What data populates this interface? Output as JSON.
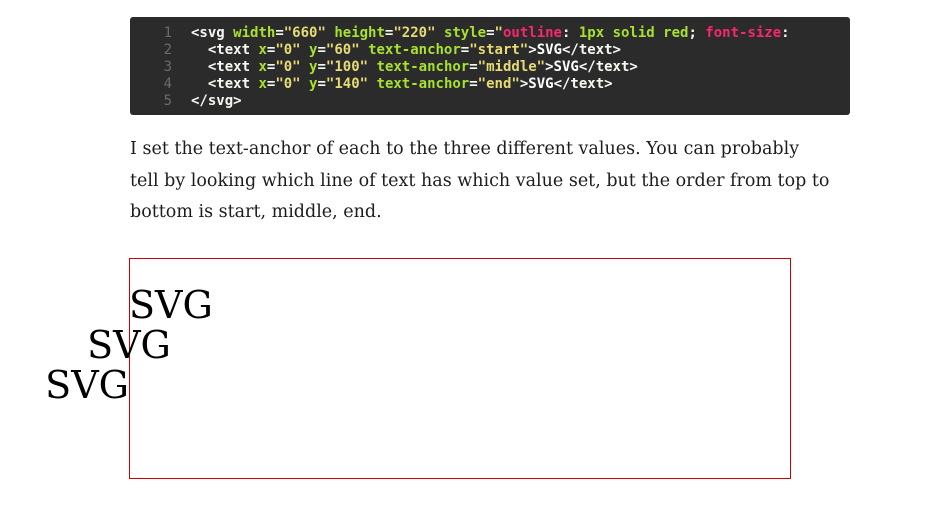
{
  "code": {
    "lines": [
      {
        "num": "1",
        "parts": [
          {
            "cls": "tag",
            "text": "<svg "
          },
          {
            "cls": "attr",
            "text": "width"
          },
          {
            "cls": "tag",
            "text": "="
          },
          {
            "cls": "str",
            "text": "\"660\""
          },
          {
            "cls": "tag",
            "text": " "
          },
          {
            "cls": "attr",
            "text": "height"
          },
          {
            "cls": "tag",
            "text": "="
          },
          {
            "cls": "str",
            "text": "\"220\""
          },
          {
            "cls": "tag",
            "text": " "
          },
          {
            "cls": "attr",
            "text": "style"
          },
          {
            "cls": "tag",
            "text": "="
          },
          {
            "cls": "str",
            "text": "\""
          },
          {
            "cls": "css-prop",
            "text": "outline"
          },
          {
            "cls": "tag",
            "text": ": "
          },
          {
            "cls": "css-val",
            "text": "1px solid red"
          },
          {
            "cls": "tag",
            "text": "; "
          },
          {
            "cls": "css-prop",
            "text": "font-size"
          },
          {
            "cls": "tag",
            "text": ":"
          }
        ]
      },
      {
        "num": "2",
        "parts": [
          {
            "cls": "tag",
            "text": "  <text "
          },
          {
            "cls": "attr",
            "text": "x"
          },
          {
            "cls": "tag",
            "text": "="
          },
          {
            "cls": "str",
            "text": "\"0\""
          },
          {
            "cls": "tag",
            "text": " "
          },
          {
            "cls": "attr",
            "text": "y"
          },
          {
            "cls": "tag",
            "text": "="
          },
          {
            "cls": "str",
            "text": "\"60\""
          },
          {
            "cls": "tag",
            "text": " "
          },
          {
            "cls": "attr",
            "text": "text-anchor"
          },
          {
            "cls": "tag",
            "text": "="
          },
          {
            "cls": "str",
            "text": "\"start\""
          },
          {
            "cls": "tag",
            "text": ">"
          },
          {
            "cls": "txt",
            "text": "SVG"
          },
          {
            "cls": "tag",
            "text": "</text>"
          }
        ]
      },
      {
        "num": "3",
        "parts": [
          {
            "cls": "tag",
            "text": "  <text "
          },
          {
            "cls": "attr",
            "text": "x"
          },
          {
            "cls": "tag",
            "text": "="
          },
          {
            "cls": "str",
            "text": "\"0\""
          },
          {
            "cls": "tag",
            "text": " "
          },
          {
            "cls": "attr",
            "text": "y"
          },
          {
            "cls": "tag",
            "text": "="
          },
          {
            "cls": "str",
            "text": "\"100\""
          },
          {
            "cls": "tag",
            "text": " "
          },
          {
            "cls": "attr",
            "text": "text-anchor"
          },
          {
            "cls": "tag",
            "text": "="
          },
          {
            "cls": "str",
            "text": "\"middle\""
          },
          {
            "cls": "tag",
            "text": ">"
          },
          {
            "cls": "txt",
            "text": "SVG"
          },
          {
            "cls": "tag",
            "text": "</text>"
          }
        ]
      },
      {
        "num": "4",
        "parts": [
          {
            "cls": "tag",
            "text": "  <text "
          },
          {
            "cls": "attr",
            "text": "x"
          },
          {
            "cls": "tag",
            "text": "="
          },
          {
            "cls": "str",
            "text": "\"0\""
          },
          {
            "cls": "tag",
            "text": " "
          },
          {
            "cls": "attr",
            "text": "y"
          },
          {
            "cls": "tag",
            "text": "="
          },
          {
            "cls": "str",
            "text": "\"140\""
          },
          {
            "cls": "tag",
            "text": " "
          },
          {
            "cls": "attr",
            "text": "text-anchor"
          },
          {
            "cls": "tag",
            "text": "="
          },
          {
            "cls": "str",
            "text": "\"end\""
          },
          {
            "cls": "tag",
            "text": ">"
          },
          {
            "cls": "txt",
            "text": "SVG"
          },
          {
            "cls": "tag",
            "text": "</text>"
          }
        ]
      },
      {
        "num": "5",
        "parts": [
          {
            "cls": "tag",
            "text": "</svg>"
          }
        ]
      }
    ]
  },
  "paragraph": "I set the text-anchor of each to the three different values. You can probably tell by looking which line of text has which value set, but the order from top to bottom is start, middle, end.",
  "demo": {
    "outline_color": "#cc0000",
    "texts": [
      {
        "label": "SVG",
        "anchor": "start"
      },
      {
        "label": "SVG",
        "anchor": "middle"
      },
      {
        "label": "SVG",
        "anchor": "end"
      }
    ]
  }
}
